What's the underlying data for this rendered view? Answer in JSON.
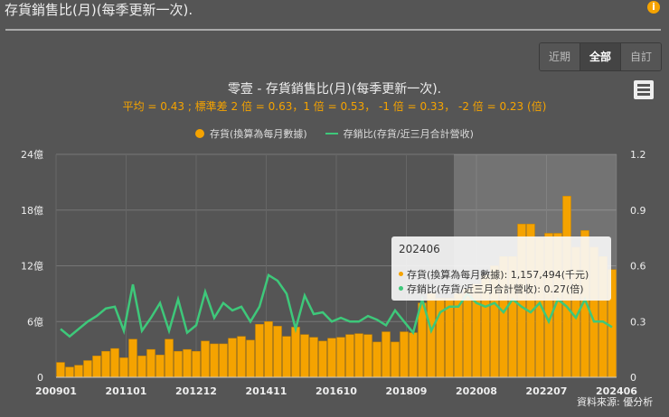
{
  "header": {
    "title": "存貨銷售比(月)(每季更新一次).",
    "info_icon": "info-icon"
  },
  "range_buttons": [
    {
      "label": "近期",
      "active": false
    },
    {
      "label": "全部",
      "active": true
    },
    {
      "label": "自訂",
      "active": false
    }
  ],
  "tooltip": {
    "date": "202406",
    "inventory_label": "存貨(換算為每月數據): 1,157,494(千元)",
    "ratio_label": "存銷比(存貨/近三月合計營收): 0.27(倍)"
  },
  "source": "資料來源: 優分析",
  "colors": {
    "bar": "#f5a300",
    "line": "#3ec87a"
  },
  "chart_data": {
    "type": "bar+line",
    "title": "零壹 - 存貨銷售比(月)(每季更新一次).",
    "subtitle": "平均 = 0.43 ; 標準差 2 倍 = 0.63，1 倍 = 0.53， -1 倍 = 0.33， -2 倍 = 0.23 (倍)",
    "legend": [
      "存貨(換算為每月數據)",
      "存銷比(存貨/近三月合計營收)"
    ],
    "legend_position": "top-center",
    "x_tick_labels": [
      "200901",
      "201101",
      "201212",
      "201411",
      "201610",
      "201809",
      "202008",
      "202207",
      "202406"
    ],
    "y_left_ticks": [
      "0",
      "6億",
      "12億",
      "18億",
      "24億"
    ],
    "y_left_range": [
      0,
      24
    ],
    "y_right_ticks": [
      "0",
      "0.3",
      "0.6",
      "0.9",
      "1.2"
    ],
    "y_right_range": [
      0,
      1.2
    ],
    "x_unit": "quarter, 2009Q1-2024Q2",
    "highlight_from_index": 44,
    "series": [
      {
        "name": "存貨(換算為每月數據)",
        "unit": "億",
        "type": "bar",
        "values": [
          1.6,
          1.1,
          1.3,
          1.8,
          2.3,
          2.8,
          3.1,
          2.1,
          4.1,
          2.3,
          3.0,
          2.4,
          4.1,
          2.8,
          3.0,
          2.8,
          3.9,
          3.6,
          3.6,
          4.2,
          4.4,
          4.0,
          5.7,
          6.0,
          5.5,
          4.4,
          5.4,
          4.6,
          4.3,
          3.9,
          4.2,
          4.3,
          4.6,
          4.7,
          4.6,
          3.8,
          4.9,
          3.8,
          4.9,
          4.8,
          8.0,
          9.0,
          8.5,
          8.5,
          9.0,
          9.5,
          10.0,
          11.0,
          12.0,
          13.0,
          13.0,
          16.5,
          16.5,
          15.0,
          15.5,
          15.5,
          19.5,
          14.0,
          15.8,
          14.0,
          13.0,
          11.6
        ]
      },
      {
        "name": "存銷比(存貨/近三月合計營收)",
        "unit": "倍",
        "type": "line",
        "values": [
          0.26,
          0.22,
          0.26,
          0.3,
          0.33,
          0.37,
          0.38,
          0.25,
          0.5,
          0.25,
          0.32,
          0.4,
          0.25,
          0.42,
          0.24,
          0.28,
          0.46,
          0.32,
          0.4,
          0.36,
          0.38,
          0.3,
          0.38,
          0.55,
          0.52,
          0.45,
          0.26,
          0.44,
          0.34,
          0.35,
          0.3,
          0.32,
          0.3,
          0.3,
          0.33,
          0.31,
          0.28,
          0.36,
          0.3,
          0.24,
          0.42,
          0.25,
          0.35,
          0.38,
          0.38,
          0.45,
          0.4,
          0.38,
          0.4,
          0.35,
          0.42,
          0.38,
          0.35,
          0.4,
          0.3,
          0.42,
          0.38,
          0.32,
          0.42,
          0.3,
          0.3,
          0.27
        ]
      }
    ]
  }
}
